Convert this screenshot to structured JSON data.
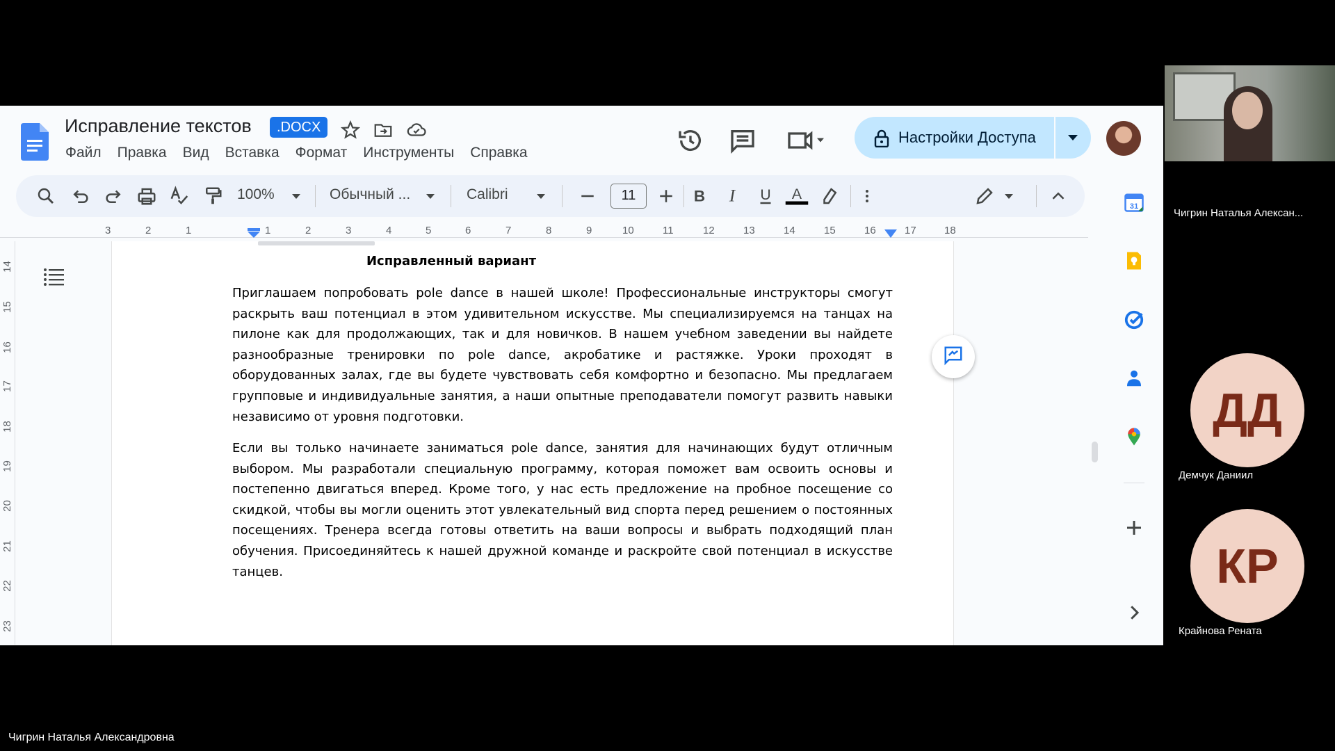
{
  "docs": {
    "title": "Исправление текстов",
    "badge": ".DOCX",
    "menu": [
      "Файл",
      "Правка",
      "Вид",
      "Вставка",
      "Формат",
      "Инструменты",
      "Справка"
    ],
    "share_label": "Настройки Доступа",
    "toolbar": {
      "zoom": "100%",
      "style": "Обычный ...",
      "font": "Calibri",
      "font_size": "11"
    },
    "ruler_h": [
      "3",
      "2",
      "1",
      "1",
      "2",
      "3",
      "4",
      "5",
      "6",
      "7",
      "8",
      "9",
      "10",
      "11",
      "12",
      "13",
      "14",
      "15",
      "16",
      "17",
      "18"
    ],
    "ruler_v": [
      "14",
      "15",
      "16",
      "17",
      "18",
      "19",
      "20",
      "21",
      "22",
      "23"
    ],
    "document": {
      "heading": "Исправленный вариант",
      "paragraphs": [
        "Приглашаем попробовать pole dance в нашей школе! Профессиональные инструкторы смогут раскрыть ваш потенциал в этом удивительном искусстве. Мы специализируемся на танцах на пилоне как для продолжающих, так и для новичков. В нашем учебном заведении вы найдете разнообразные тренировки по pole dance, акробатике и растяжке. Уроки проходят в оборудованных залах, где вы будете чувствовать себя комфортно и безопасно. Мы предлагаем групповые и индивидуальные занятия, а наши опытные преподаватели помогут развить навыки независимо от уровня подготовки.",
        "Если вы только начинаете заниматься pole dance, занятия для начинающих будут отличным выбором. Мы разработали специальную программу, которая поможет вам освоить основы и постепенно двигаться вперед. Кроме того, у нас есть предложение на пробное посещение со скидкой, чтобы вы могли оценить этот увлекательный вид спорта перед решением о постоянных посещениях. Тренера всегда готовы ответить на ваши вопросы и выбрать подходящий план обучения. Присоединяйтесь к нашей дружной команде и раскройте свой потенциал в искусстве танцев."
      ]
    }
  },
  "participants": {
    "camera_name": "Чигрин Наталья Алексан...",
    "p1_initials": "ДД",
    "p1_name": "Демчук Даниил",
    "p2_initials": "КР",
    "p2_name": "Крайнова Рената",
    "presenter": "Чигрин Наталья Александровна"
  },
  "colors": {
    "accent": "#1a73e8",
    "share_bg": "#c2e7ff",
    "avatar_bg": "#f2d3c6",
    "avatar_text": "#7a2a18"
  }
}
